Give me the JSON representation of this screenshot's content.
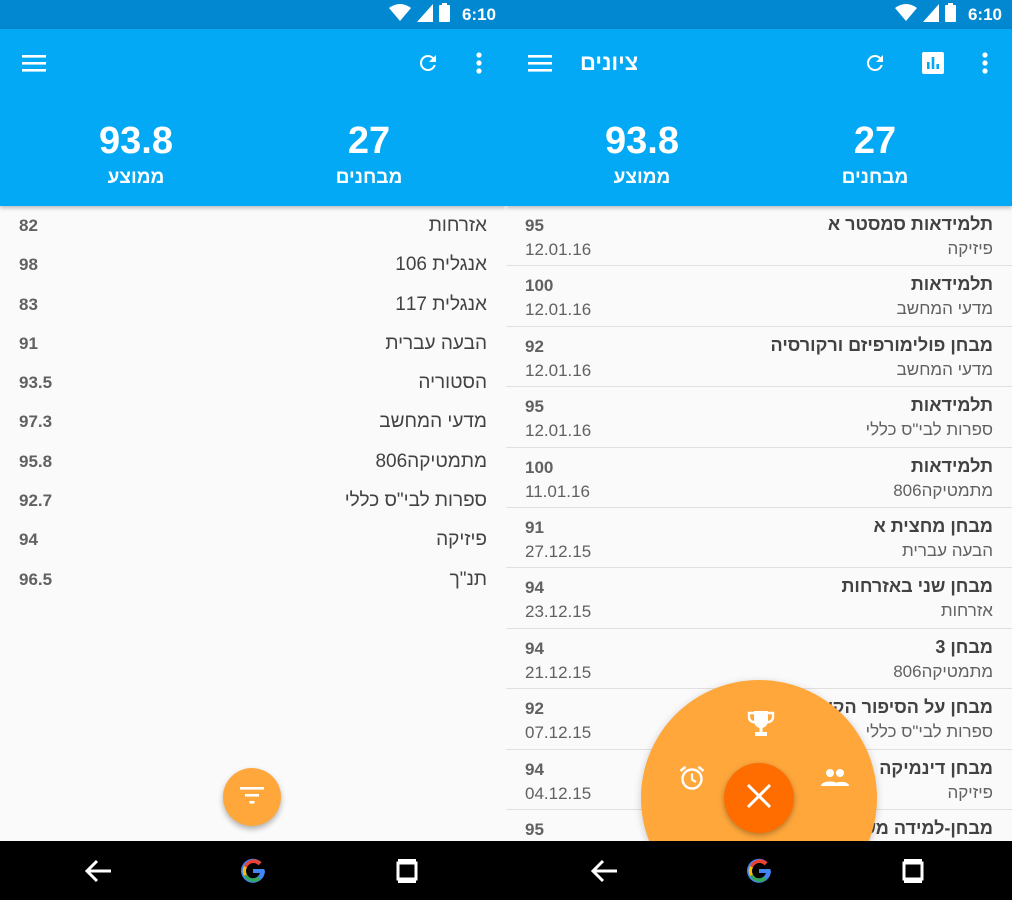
{
  "status": {
    "time": "6:10"
  },
  "grades_screen": {
    "stats": {
      "tests_value": "27",
      "tests_label": "מבחנים",
      "average_value": "93.8",
      "average_label": "ממוצע"
    },
    "grades": [
      {
        "subject": "אזרחות",
        "grade": "82"
      },
      {
        "subject": "אנגלית 106",
        "grade": "98"
      },
      {
        "subject": "אנגלית 117",
        "grade": "83"
      },
      {
        "subject": "הבעה עברית",
        "grade": "91"
      },
      {
        "subject": "הסטוריה",
        "grade": "93.5"
      },
      {
        "subject": "מדעי המחשב",
        "grade": "97.3"
      },
      {
        "subject": "מתמטיקה806",
        "grade": "95.8"
      },
      {
        "subject": "ספרות לבי\"ס כללי",
        "grade": "92.7"
      },
      {
        "subject": "פיזיקה",
        "grade": "94"
      },
      {
        "subject": "תנ\"ך",
        "grade": "96.5"
      }
    ],
    "icons": {
      "menu": "menu-icon",
      "refresh": "refresh-icon",
      "more": "more-vert-icon",
      "filter": "filter-icon"
    }
  },
  "tests_screen": {
    "title": "ציונים",
    "stats": {
      "tests_value": "27",
      "tests_label": "מבחנים",
      "average_value": "93.8",
      "average_label": "ממוצע"
    },
    "tests": [
      {
        "name": "תלמידאות סמסטר א",
        "subject": "פיזיקה",
        "grade": "95",
        "date": "12.01.16"
      },
      {
        "name": "תלמידאות",
        "subject": "מדעי המחשב",
        "grade": "100",
        "date": "12.01.16"
      },
      {
        "name": "מבחן פולימורפיזם ורקורסיה",
        "subject": "מדעי המחשב",
        "grade": "92",
        "date": "12.01.16"
      },
      {
        "name": "תלמידאות",
        "subject": "ספרות לבי\"ס כללי",
        "grade": "95",
        "date": "12.01.16"
      },
      {
        "name": "תלמידאות",
        "subject": "מתמטיקה806",
        "grade": "100",
        "date": "11.01.16"
      },
      {
        "name": "מבחן מחצית א",
        "subject": "הבעה עברית",
        "grade": "91",
        "date": "27.12.15"
      },
      {
        "name": "מבחן שני באזרחות",
        "subject": "אזרחות",
        "grade": "94",
        "date": "23.12.15"
      },
      {
        "name": "מבחן 3",
        "subject": "מתמטיקה806",
        "grade": "94",
        "date": "21.12.15"
      },
      {
        "name": "מבחן על הסיפור הקצר",
        "subject": "ספרות לבי\"ס כללי",
        "grade": "92",
        "date": "07.12.15"
      },
      {
        "name": "מבחן דינמיקה",
        "subject": "פיזיקה",
        "grade": "94",
        "date": "04.12.15"
      },
      {
        "name": "מבחן-למידה משולבת",
        "subject": "",
        "grade": "95",
        "date": ""
      }
    ],
    "icons": {
      "menu": "menu-icon",
      "refresh": "refresh-icon",
      "chart": "bar-chart-icon",
      "more": "more-vert-icon"
    },
    "fab_menu": {
      "actions": [
        "trophy-icon",
        "alarm-icon",
        "people-icon",
        "close-icon"
      ],
      "accent": "#ffa73b",
      "close_color": "#ff6d00"
    }
  },
  "colors": {
    "statusbar": "#0288d1",
    "appbar": "#03a9f4",
    "fab": "#ffa73b"
  }
}
